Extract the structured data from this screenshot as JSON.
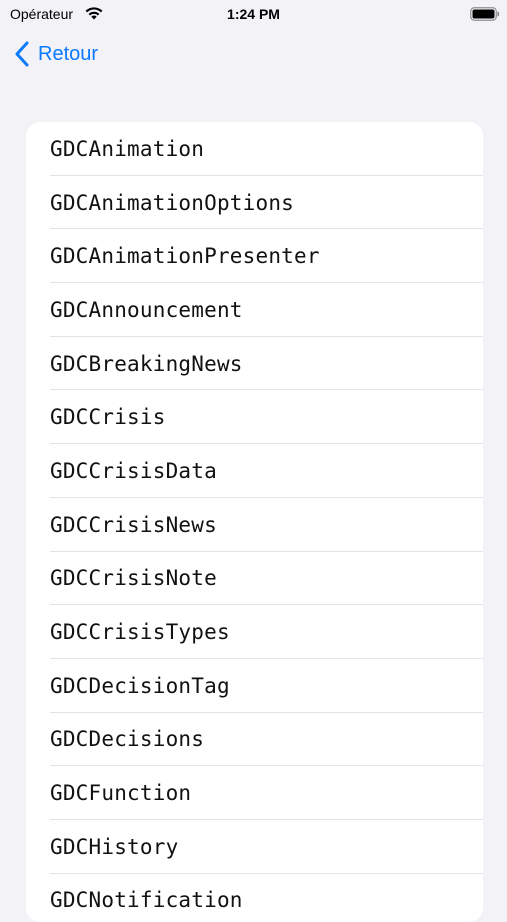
{
  "status_bar": {
    "carrier": "Opérateur",
    "time": "1:24 PM",
    "wifi_icon": "wifi-icon",
    "battery_icon": "battery-icon"
  },
  "nav": {
    "back_label": "Retour",
    "back_icon": "chevron-left-icon",
    "accent_color": "#0a7aff"
  },
  "list": {
    "items": [
      {
        "label": "GDCAnimation"
      },
      {
        "label": "GDCAnimationOptions"
      },
      {
        "label": "GDCAnimationPresenter"
      },
      {
        "label": "GDCAnnouncement"
      },
      {
        "label": "GDCBreakingNews"
      },
      {
        "label": "GDCCrisis"
      },
      {
        "label": "GDCCrisisData"
      },
      {
        "label": "GDCCrisisNews"
      },
      {
        "label": "GDCCrisisNote"
      },
      {
        "label": "GDCCrisisTypes"
      },
      {
        "label": "GDCDecisionTag"
      },
      {
        "label": "GDCDecisions"
      },
      {
        "label": "GDCFunction"
      },
      {
        "label": "GDCHistory"
      },
      {
        "label": "GDCNotification"
      }
    ]
  }
}
